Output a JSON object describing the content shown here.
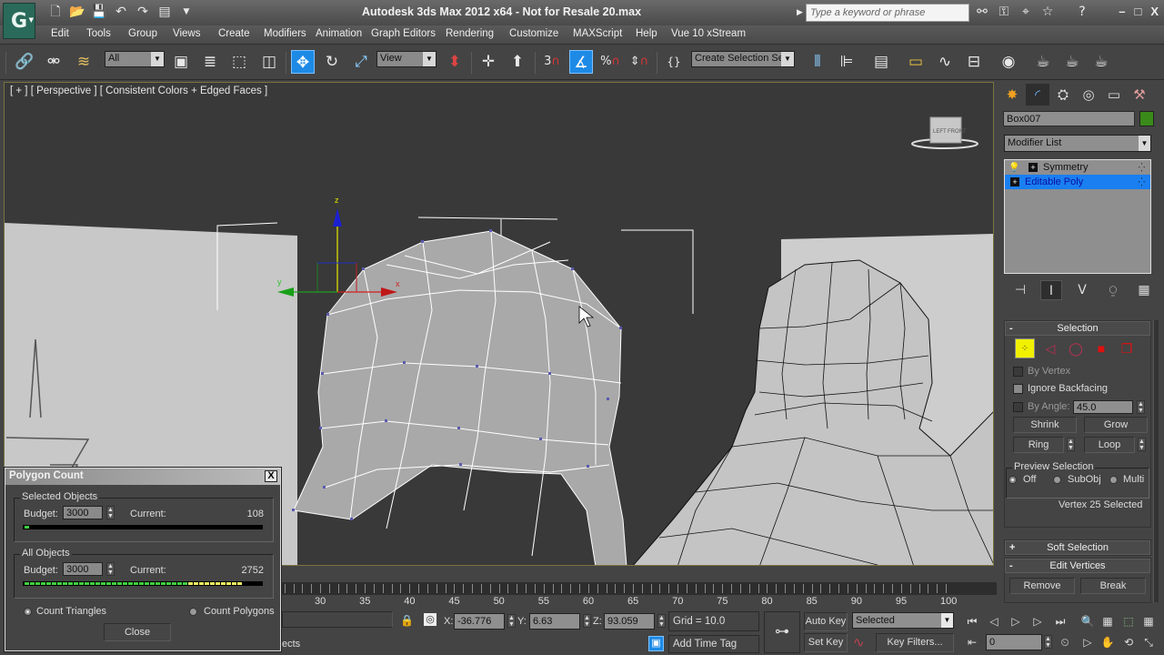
{
  "window": {
    "title": "Autodesk 3ds Max  2012 x64  - Not for Resale   20.max",
    "search_placeholder": "Type a keyword or phrase",
    "controls": {
      "minimize": "–",
      "maximize": "□",
      "close": "X"
    }
  },
  "quick_access": [
    "new-icon",
    "open-icon",
    "save-icon",
    "undo-icon",
    "redo-icon",
    "project-folder-icon",
    "customize-dropdown-icon"
  ],
  "menu": [
    "Edit",
    "Tools",
    "Group",
    "Views",
    "Create",
    "Modifiers",
    "Animation",
    "Graph Editors",
    "Rendering",
    "Customize",
    "MAXScript",
    "Help",
    "Vue 10 xStream"
  ],
  "toolbar": {
    "selection_filter": "All",
    "ref_coord": "View",
    "named_selection": "Create Selection Set",
    "named_selection_visible": "Create Selection Sel",
    "snap_label": "3",
    "active_tool": "select-and-move"
  },
  "viewport": {
    "label": "[ + ] [ Perspective ] [ Consistent Colors + Edged Faces ]",
    "gizmo": {
      "x": "x",
      "y": "y",
      "z": "z"
    },
    "viewcube_faces": [
      "LEFT",
      "FRONT"
    ]
  },
  "command_panel": {
    "object_name": "Box007",
    "object_color": "#3a8a1a",
    "modifier_list": "Modifier List",
    "stack": [
      {
        "label": "Symmetry",
        "selected": false
      },
      {
        "label": "Editable Poly",
        "selected": true
      }
    ],
    "selection_rollout": {
      "title": "Selection",
      "by_vertex": "By Vertex",
      "ignore_backfacing": "Ignore Backfacing",
      "by_angle": "By Angle:",
      "angle_value": "45.0",
      "shrink": "Shrink",
      "grow": "Grow",
      "ring": "Ring",
      "loop": "Loop",
      "preview_title": "Preview Selection",
      "preview_options": [
        "Off",
        "SubObj",
        "Multi"
      ],
      "preview_selected": "Off",
      "status": "Vertex 25 Selected"
    },
    "soft_selection": "Soft Selection",
    "edit_vertices": {
      "title": "Edit Vertices",
      "remove": "Remove",
      "break": "Break"
    }
  },
  "polygon_count": {
    "title": "Polygon Count",
    "close_label": "X",
    "selected": {
      "title": "Selected Objects",
      "budget_label": "Budget:",
      "budget": "3000",
      "current_label": "Current:",
      "current": "108",
      "fill_fraction": 0.036
    },
    "all": {
      "title": "All Objects",
      "budget_label": "Budget:",
      "budget": "3000",
      "current_label": "Current:",
      "current": "2752",
      "fill_fraction": 0.917,
      "green_fraction": 0.67
    },
    "count_triangles": "Count Triangles",
    "count_polygons": "Count Polygons",
    "count_mode": "triangles",
    "close_button": "Close"
  },
  "timeline": {
    "frame_labels": [
      "30",
      "35",
      "40",
      "45",
      "50",
      "55",
      "60",
      "65",
      "70",
      "75",
      "80",
      "85",
      "90",
      "95",
      "100"
    ]
  },
  "status_bar": {
    "prompt_fragment": "ects",
    "x_label": "X:",
    "x": "-36.776",
    "y_label": "Y:",
    "y": "6.63",
    "z_label": "Z:",
    "z": "93.059",
    "grid": "Grid = 10.0",
    "add_time_tag": "Add Time Tag",
    "auto_key": "Auto Key",
    "set_key": "Set Key",
    "key_mode": "Selected",
    "key_filters": "Key Filters...",
    "current_frame": "0"
  }
}
